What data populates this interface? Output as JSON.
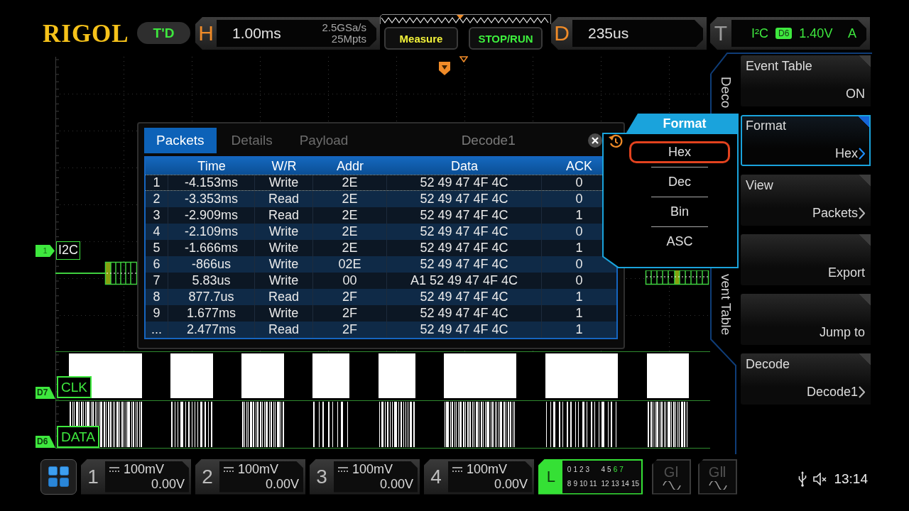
{
  "header": {
    "logo": "RIGOL",
    "mode": "T'D",
    "horizontal": {
      "letter": "H",
      "timebase": "1.00ms",
      "sample_rate": "2.5GSa/s",
      "memory_depth": "25Mpts"
    },
    "buttons": [
      {
        "label": "Measure",
        "kind": "measure"
      },
      {
        "label": "STOP/RUN",
        "kind": "run"
      }
    ],
    "delay": {
      "letter": "D",
      "value": "235us"
    },
    "trigger": {
      "letter": "T",
      "type": "I²C",
      "source": "D6",
      "level": "1.40V",
      "sweep": "A"
    }
  },
  "waveform_area": {
    "bus": {
      "number": "1",
      "label": "I2C"
    },
    "digital_channels": [
      {
        "tag": "D7",
        "label": "CLK",
        "kind": "clock"
      },
      {
        "tag": "D6",
        "label": "DATA",
        "kind": "data"
      }
    ]
  },
  "event_table": {
    "tabs": [
      {
        "label": "Packets",
        "selected": true
      },
      {
        "label": "Details",
        "selected": false
      },
      {
        "label": "Payload",
        "selected": false
      }
    ],
    "title": "Decode1",
    "columns": [
      "Time",
      "W/R",
      "Addr",
      "Data",
      "ACK"
    ],
    "rows": [
      {
        "number": "1",
        "cells": [
          "-4.153ms",
          "Write",
          "2E",
          "52 49 47 4F 4C",
          "0"
        ],
        "selected": true
      },
      {
        "number": "2",
        "cells": [
          "-3.353ms",
          "Read",
          "2E",
          "52 49 47 4F 4C",
          "0"
        ],
        "selected": false
      },
      {
        "number": "3",
        "cells": [
          "-2.909ms",
          "Read",
          "2E",
          "52 49 47 4F 4C",
          "1"
        ],
        "selected": false
      },
      {
        "number": "4",
        "cells": [
          "-2.109ms",
          "Write",
          "2E",
          "52 49 47 4F 4C",
          "0"
        ],
        "selected": false
      },
      {
        "number": "5",
        "cells": [
          "-1.666ms",
          "Write",
          "2E",
          "52 49 47 4F 4C",
          "1"
        ],
        "selected": false
      },
      {
        "number": "6",
        "cells": [
          "-866us",
          "Write",
          "02E",
          "52 49 47 4F 4C",
          "0"
        ],
        "selected": false
      },
      {
        "number": "7",
        "cells": [
          "5.83us",
          "Write",
          "00",
          "A1 52 49 47 4F 4C",
          "0"
        ],
        "selected": false
      },
      {
        "number": "8",
        "cells": [
          "877.7us",
          "Read",
          "2F",
          "52 49 47 4F 4C",
          "1"
        ],
        "selected": false
      },
      {
        "number": "9",
        "cells": [
          "1.677ms",
          "Write",
          "2F",
          "52 49 47 4F 4C",
          "1"
        ],
        "selected": false
      },
      {
        "number": "...",
        "cells": [
          "2.477ms",
          "Read",
          "2F",
          "52 49 47 4F 4C",
          "1"
        ],
        "selected": false
      }
    ]
  },
  "format_menu": {
    "title": "Format",
    "options": [
      {
        "label": "Hex",
        "selected": true
      },
      {
        "label": "Dec",
        "selected": false
      },
      {
        "label": "Bin",
        "selected": false
      },
      {
        "label": "ASC",
        "selected": false
      }
    ]
  },
  "side_menu": {
    "caption_parts": [
      "Deco",
      "vent Table"
    ],
    "items": [
      {
        "label": "Event Table",
        "value": "ON",
        "selected": false,
        "submenu": false
      },
      {
        "label": "Format",
        "value": "Hex",
        "selected": true,
        "submenu": true
      },
      {
        "label": "View",
        "value": "Packets",
        "selected": false,
        "submenu": true
      },
      {
        "value": "Export",
        "selected": false,
        "submenu": false
      },
      {
        "value": "Jump to",
        "selected": false,
        "submenu": false
      },
      {
        "label": "Decode",
        "value": "Decode1",
        "selected": false,
        "submenu": true
      }
    ]
  },
  "bottom_bar": {
    "analog_channels": [
      {
        "number": "1",
        "scale": "100mV",
        "offset": "0.00V",
        "on": false
      },
      {
        "number": "2",
        "scale": "100mV",
        "offset": "0.00V",
        "on": false
      },
      {
        "number": "3",
        "scale": "100mV",
        "offset": "0.00V",
        "on": false
      },
      {
        "number": "4",
        "scale": "100mV",
        "offset": "0.00V",
        "on": false
      }
    ],
    "logic": {
      "letter": "L",
      "on": true,
      "channels": [
        {
          "label": "0",
          "on": false
        },
        {
          "label": "1",
          "on": false
        },
        {
          "label": "2",
          "on": false
        },
        {
          "label": "3",
          "on": false
        },
        {
          "label": "4",
          "on": false
        },
        {
          "label": "5",
          "on": false
        },
        {
          "label": "6",
          "on": true
        },
        {
          "label": "7",
          "on": true
        },
        {
          "label": "8",
          "on": false
        },
        {
          "label": "9",
          "on": false
        },
        {
          "label": "10",
          "on": false
        },
        {
          "label": "11",
          "on": false
        },
        {
          "label": "12",
          "on": false
        },
        {
          "label": "13",
          "on": false
        },
        {
          "label": "14",
          "on": false
        },
        {
          "label": "15",
          "on": false
        }
      ]
    },
    "generators": [
      {
        "label": "GⅠ",
        "on": false
      },
      {
        "label": "GⅡ",
        "on": false
      }
    ],
    "time": "13:14"
  }
}
